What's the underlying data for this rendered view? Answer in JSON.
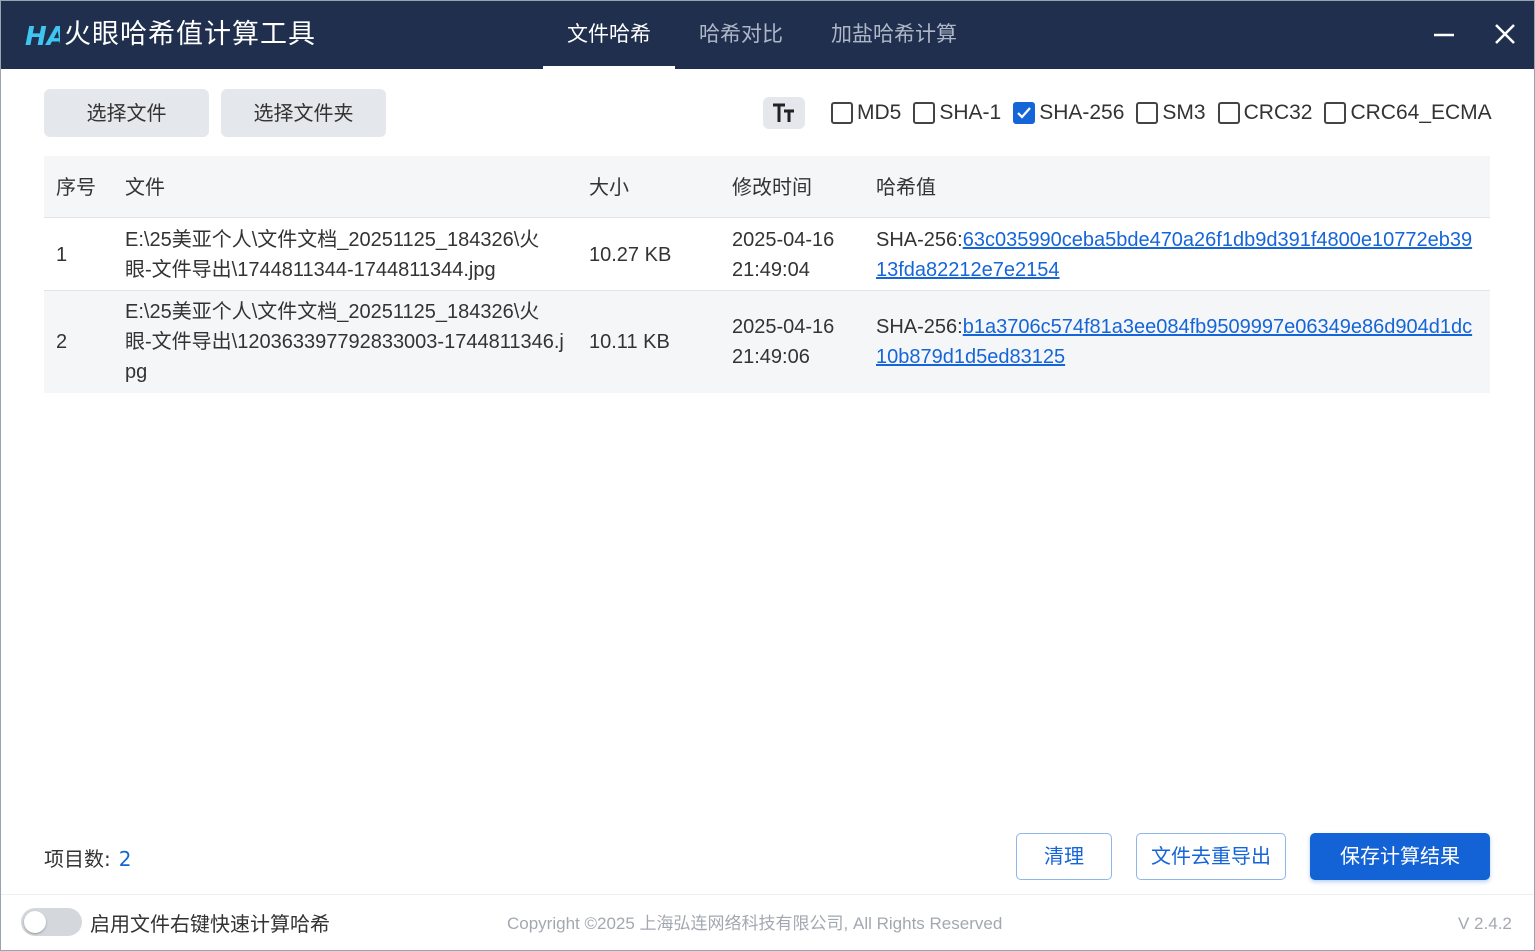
{
  "app": {
    "title": "火眼哈希值计算工具",
    "logo_text": "HA",
    "brand_color": "#1f2f4d",
    "accent_color": "#1565d8"
  },
  "tabs": [
    {
      "label": "文件哈希",
      "active": true
    },
    {
      "label": "哈希对比",
      "active": false
    },
    {
      "label": "加盐哈希计算",
      "active": false
    }
  ],
  "window_controls": {
    "minimize_icon": "minimize-icon",
    "close_icon": "close-icon"
  },
  "toolbar": {
    "select_file": "选择文件",
    "select_folder": "选择文件夹",
    "font_size_icon": "text-size-icon",
    "algorithms": [
      {
        "label": "MD5",
        "checked": false
      },
      {
        "label": "SHA-1",
        "checked": false
      },
      {
        "label": "SHA-256",
        "checked": true
      },
      {
        "label": "SM3",
        "checked": false
      },
      {
        "label": "CRC32",
        "checked": false
      },
      {
        "label": "CRC64_ECMA",
        "checked": false
      }
    ]
  },
  "table": {
    "headers": [
      "序号",
      "文件",
      "大小",
      "修改时间",
      "哈希值"
    ],
    "rows": [
      {
        "index": "1",
        "file": "E:\\25美亚个人\\文件文档_20251125_184326\\火眼-文件导出\\1744811344-1744811344.jpg",
        "size": "10.27 KB",
        "modified": "2025-04-16 21:49:04",
        "hash_prefix": "SHA-256:",
        "hash_value": "63c035990ceba5bde470a26f1db9d391f4800e10772eb3913fda82212e7e2154"
      },
      {
        "index": "2",
        "file": "E:\\25美亚个人\\文件文档_20251125_184326\\火眼-文件导出\\120363397792833003-1744811346.jpg",
        "size": "10.11 KB",
        "modified": "2025-04-16 21:49:06",
        "hash_prefix": "SHA-256:",
        "hash_value": "b1a3706c574f81a3ee084fb9509997e06349e86d904d1dc10b879d1d5ed83125"
      }
    ]
  },
  "summary": {
    "count_label": "项目数:",
    "count_value": "2"
  },
  "actions": {
    "clear": "清理",
    "dedup_export": "文件去重导出",
    "save": "保存计算结果"
  },
  "footer": {
    "context_menu_toggle": {
      "label": "启用文件右键快速计算哈希",
      "enabled": false
    },
    "copyright": "Copyright ©2025 上海弘连网络科技有限公司, All Rights Reserved",
    "version": "V 2.4.2"
  }
}
